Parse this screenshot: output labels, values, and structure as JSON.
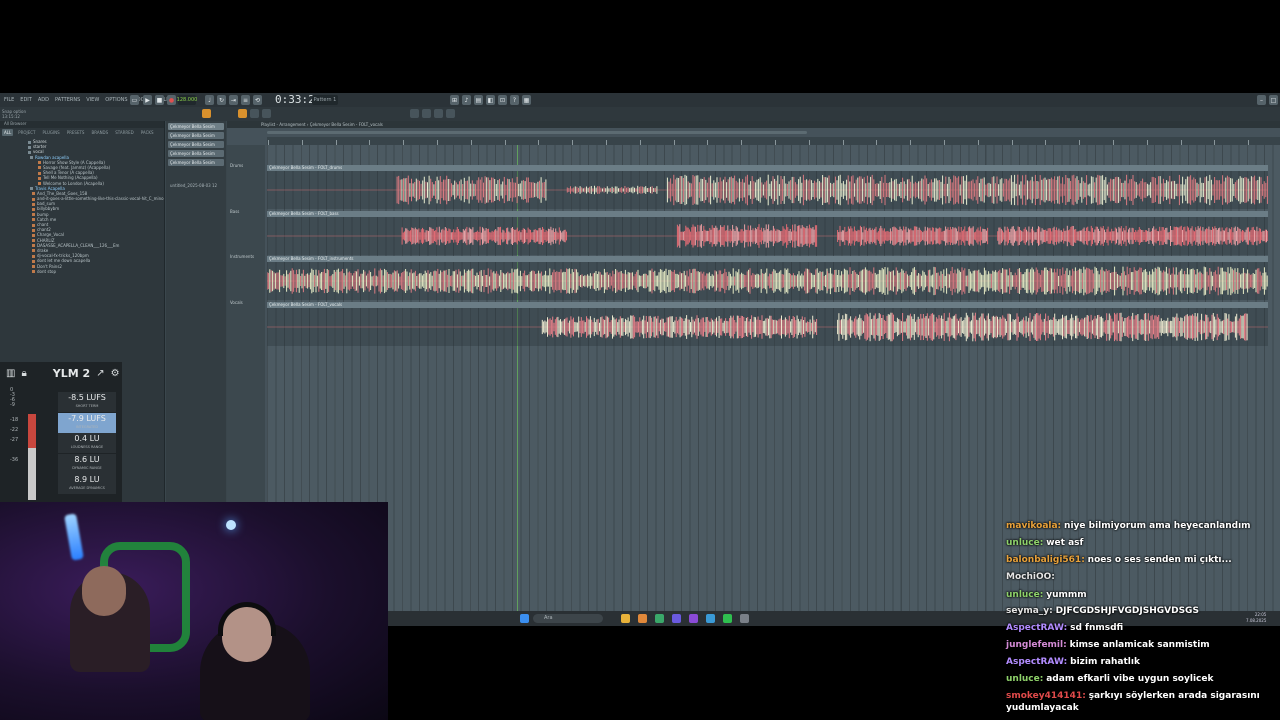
{
  "daw": {
    "menu": [
      "FILE",
      "EDIT",
      "ADD",
      "PATTERNS",
      "VIEW",
      "OPTIONS",
      "TOOLS",
      "HELP"
    ],
    "time": "0:33:22",
    "tempo": "128.000",
    "pattern_selector": "Pattern 1",
    "hint_line1": "Snap option",
    "hint_line2": "13:15:12",
    "browser": {
      "header": "All  Browser",
      "tabs": [
        "ALL",
        "PROJECT",
        "PLUGINS",
        "PRESETS",
        "BRANDS",
        "STARRED",
        "PACKS"
      ],
      "tree": [
        {
          "label": "Snares",
          "type": "folder"
        },
        {
          "label": "starter",
          "type": "folder"
        },
        {
          "label": "vocal",
          "type": "folder"
        },
        {
          "label": "Rowdan acapella",
          "type": "folder",
          "hl": true
        },
        {
          "label": "Horror Show Style (A Cappella)",
          "type": "file"
        },
        {
          "label": "Savage (feat. Jammz) (Acappella)",
          "type": "file"
        },
        {
          "label": "Shell a Tenor (A cappella)",
          "type": "file"
        },
        {
          "label": "Tell Me Nothing (Acappella)",
          "type": "file"
        },
        {
          "label": "Welcome to London (Acapella)",
          "type": "file"
        },
        {
          "label": "Travis Acapella",
          "type": "folder",
          "hl": true
        },
        {
          "label": "And_The_Beat_Goes_158",
          "type": "file"
        },
        {
          "label": "and-it-goes-a-little-something-like-this-classic-vocal-hit_C_minor",
          "type": "file"
        },
        {
          "label": "bad_sum",
          "type": "file"
        },
        {
          "label": "billybbybm",
          "type": "file"
        },
        {
          "label": "bump",
          "type": "file"
        },
        {
          "label": "Catch me",
          "type": "file"
        },
        {
          "label": "chant",
          "type": "file"
        },
        {
          "label": "chant2",
          "type": "file"
        },
        {
          "label": "Charge_Vocal",
          "type": "file"
        },
        {
          "label": "CHARLIZ",
          "type": "file"
        },
        {
          "label": "DASASSE_ACAPELLA_CLEAN___126___Em",
          "type": "file"
        },
        {
          "label": "drake",
          "type": "file"
        },
        {
          "label": "dj-vocal-fx-tricks_120bpm",
          "type": "file"
        },
        {
          "label": "dont let me down acapella",
          "type": "file"
        },
        {
          "label": "Don't Pains2",
          "type": "file"
        },
        {
          "label": "dont stop",
          "type": "file"
        }
      ]
    },
    "channels": [
      "Çekmeyor Bella Sesim",
      "Çekmeyor Bella Sesim",
      "Çekmeyor Bella Sesim",
      "Çekmeyor Bella Sesim",
      "Çekmeyor Bella Sesim"
    ],
    "channel_footer": "untitled_2025-08-03 12",
    "playlist_title": "Playlist - Arrangement › Çekmeyor Bella Sesim - FOLT_vocals",
    "tracks": [
      {
        "name": "Drums",
        "clip": "Çekmeyor Bella Sesim - FOLT_drums"
      },
      {
        "name": "Bass",
        "clip": "Çekmeyor Bella Sesim - FOLT_bass"
      },
      {
        "name": "Instruments",
        "clip": "Çekmeyor Bella Sesim - FOLT_instruments"
      },
      {
        "name": "Vocals",
        "clip": "Çekmeyor Bella Sesim - FOLT_vocals"
      }
    ],
    "taskbar_search": "Ara",
    "clock_time": "22:05",
    "clock_date": "7.08.2025"
  },
  "ylm": {
    "title": "YLM 2",
    "scale": [
      "0",
      "-3",
      "-6",
      "-9",
      "",
      "-18",
      "-22",
      "-27",
      "",
      "-36"
    ],
    "stats": [
      {
        "value": "-8.5 LUFS",
        "label": "SHORT TERM"
      },
      {
        "value": "-7.9 LUFS",
        "label": "INTEGRATED",
        "selected": true
      },
      {
        "value": "0.4 LU",
        "label": "LOUDNESS RANGE"
      },
      {
        "value": "8.6 LU",
        "label": "DYNAMIC RANGE"
      },
      {
        "value": "8.9 LU",
        "label": "AVERAGE DYNAMICS"
      }
    ],
    "meter_level_fraction": 0.4
  },
  "chat": [
    {
      "user": "mavikoala:",
      "text": "niye bilmiyorum ama heyecanlandım",
      "color": "#e9a23b"
    },
    {
      "user": "unluce:",
      "text": "wet asf",
      "color": "#8ed16a"
    },
    {
      "user": "balonbaligi561:",
      "text": "noes o ses senden mi çıktı...",
      "color": "#e9a23b"
    },
    {
      "user": "MochiOO:",
      "text": "",
      "color": "#e6e6e6"
    },
    {
      "user": "unluce:",
      "text": "yummm",
      "color": "#8ed16a"
    },
    {
      "user": "seyma_y:",
      "text": "DJFCGDSHJFVGDJSHGVDSGS",
      "color": "#e6e6e6"
    },
    {
      "user": "AspectRAW:",
      "text": "sd fnmsdfi",
      "color": "#b28cff"
    },
    {
      "user": "junglefemil:",
      "text": "kimse anlamicak sanmistim",
      "color": "#d48bd6"
    },
    {
      "user": "AspectRAW:",
      "text": "bizim rahatlık",
      "color": "#b28cff"
    },
    {
      "user": "unluce:",
      "text": "adam efkarli vibe uygun soylicek",
      "color": "#8ed16a"
    },
    {
      "user": "smokey414141:",
      "text": "şarkıyı söylerken arada sigarasını yudumlayacak",
      "color": "#e04a4a"
    }
  ]
}
